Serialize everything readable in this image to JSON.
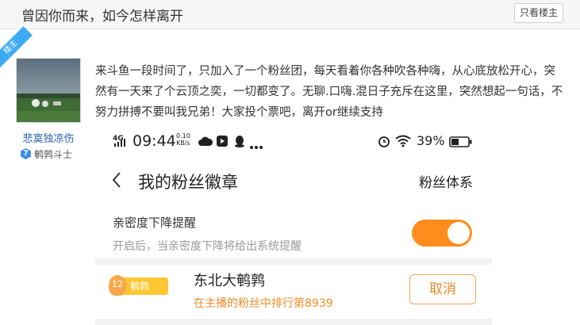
{
  "thread": {
    "title": "曾因你而来，如今怎样离开",
    "only_host_label": "只看楼主"
  },
  "host_badge": "楼主",
  "author": {
    "name": "悲寞独凉伤",
    "level_number": "7",
    "level_title": "鹌鹑斗士"
  },
  "post": {
    "text": "来斗鱼一段时间了，只加入了一个粉丝团，每天看着你各种吹各种嗨，从心底放松开心，突然有一天来了个云顶之奕，一切都变了。无聊.口嗨.混日子充斥在这里，突然想起一句话，不努力拼搏不要叫我兄弟！大家投个票吧，离开or继续支持"
  },
  "phone": {
    "status": {
      "signal": "4G",
      "time": "09:44",
      "speed_value": "0.10",
      "speed_unit": "KB/s",
      "battery": "39%"
    },
    "nav": {
      "title": "我的粉丝徽章",
      "right_label": "粉丝体系"
    },
    "setting": {
      "label": "亲密度下降提醒",
      "desc": "开启后，当亲密度下降将给出系统提醒",
      "enabled": true
    },
    "fan_badge": {
      "level": "12",
      "medal_name": "鹌鹑",
      "streamer": "东北大鹌鹑",
      "rank_text": "在主播的粉丝中排行第8939",
      "cancel_label": "取消"
    }
  },
  "colors": {
    "accent_orange": "#ff8c1c",
    "ribbon_blue": "#3eaaf4",
    "author_blue": "#2d64b3"
  }
}
